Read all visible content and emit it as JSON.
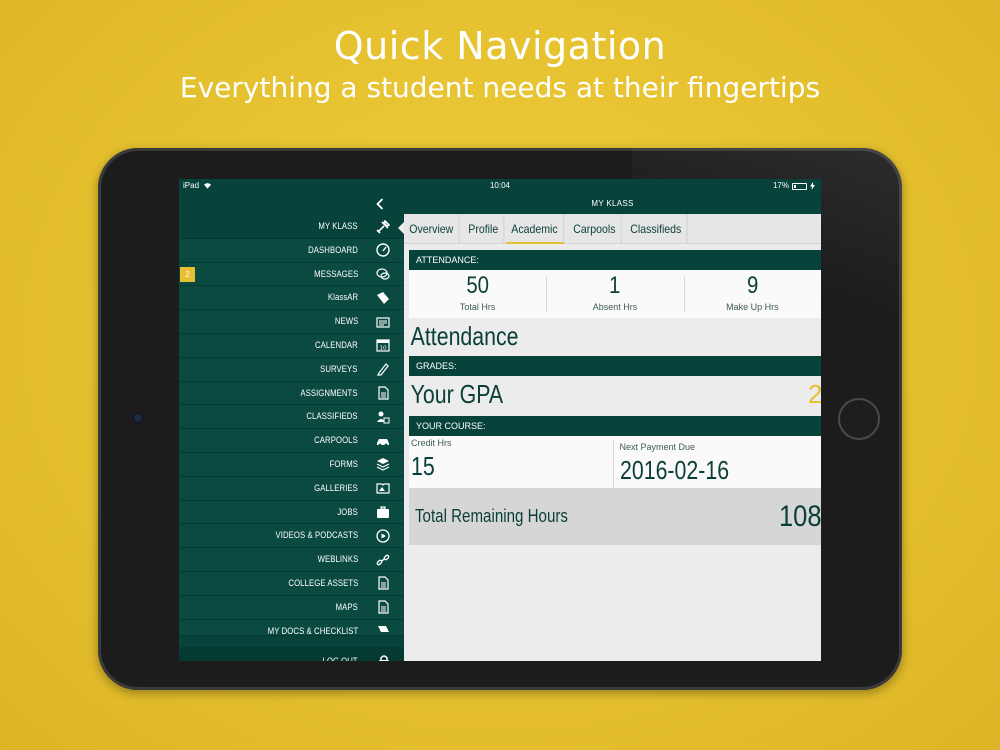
{
  "promo": {
    "title": "Quick Navigation",
    "subtitle": "Everything a student needs at their fingertips"
  },
  "status_bar": {
    "device": "iPad",
    "time": "10:04",
    "battery": "17%"
  },
  "header": {
    "title": "MY KLASS",
    "back_icon": "chevron-left-icon"
  },
  "sidebar": {
    "items": [
      {
        "label": "MY KLASS",
        "icon": "tools-icon",
        "active": true
      },
      {
        "label": "DASHBOARD",
        "icon": "gauge-icon"
      },
      {
        "label": "MESSAGES",
        "icon": "chat-bubbles-icon",
        "badge": "2"
      },
      {
        "label": "KlassAR",
        "icon": "ar-book-icon"
      },
      {
        "label": "NEWS",
        "icon": "newspaper-icon"
      },
      {
        "label": "CALENDAR",
        "icon": "calendar-icon",
        "icon_text": "10"
      },
      {
        "label": "SURVEYS",
        "icon": "pencil-icon"
      },
      {
        "label": "ASSIGNMENTS",
        "icon": "document-icon"
      },
      {
        "label": "CLASSIFIEDS",
        "icon": "people-tag-icon"
      },
      {
        "label": "CARPOOLS",
        "icon": "car-icon"
      },
      {
        "label": "FORMS",
        "icon": "layers-icon"
      },
      {
        "label": "GALLERIES",
        "icon": "photo-book-icon"
      },
      {
        "label": "JOBS",
        "icon": "briefcase-icon"
      },
      {
        "label": "VIDEOS & PODCASTS",
        "icon": "play-circle-icon"
      },
      {
        "label": "WEBLINKS",
        "icon": "link-icon"
      },
      {
        "label": "COLLEGE ASSETS",
        "icon": "document-icon"
      },
      {
        "label": "MAPS",
        "icon": "document-icon"
      },
      {
        "label": "MY DOCS & CHECKLIST",
        "icon": "docs-icon"
      }
    ],
    "logout": {
      "label": "LOG OUT",
      "icon": "lock-icon"
    }
  },
  "tabs": [
    {
      "label": "Overview"
    },
    {
      "label": "Profile"
    },
    {
      "label": "Academic",
      "active": true
    },
    {
      "label": "Carpools"
    },
    {
      "label": "Classifieds"
    }
  ],
  "attendance": {
    "header": "ATTENDANCE:",
    "stats": [
      {
        "value": "50",
        "label": "Total Hrs"
      },
      {
        "value": "1",
        "label": "Absent Hrs"
      },
      {
        "value": "9",
        "label": "Make Up Hrs"
      }
    ],
    "title": "Attendance"
  },
  "grades": {
    "header": "GRADES:",
    "title": "Your GPA",
    "value": "2"
  },
  "course": {
    "header": "YOUR COURSE:",
    "credit_label": "Credit Hrs",
    "credit_value": "15",
    "payment_label": "Next Payment Due",
    "payment_value": "2016-02-16",
    "remaining_label": "Total Remaining Hours",
    "remaining_value": "108"
  },
  "colors": {
    "background": "#e6c030",
    "brand_green": "#07433b",
    "accent_yellow": "#e6c030",
    "content_bg": "#ececec"
  }
}
